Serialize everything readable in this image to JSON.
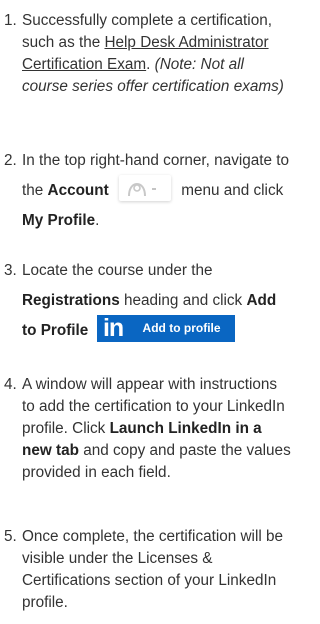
{
  "steps": [
    {
      "num": "1.",
      "l1": "Successfully complete a certification,",
      "l2a": "such as the ",
      "l2link": "Help Desk Administrator",
      "l3link": "Certification Exam",
      "l3b": ". ",
      "l3note": "(Note: Not all",
      "l4note": "course series offer certification exams)"
    },
    {
      "num": "2.",
      "l1": "In the top right-hand corner, navigate to",
      "l2a": "the ",
      "l2bold": "Account",
      "l2c": "menu and click",
      "l3bold": "My Profile",
      "l3b": "."
    },
    {
      "num": "3.",
      "l1": "Locate the course under the",
      "l2bold": "Registrations",
      "l2b": " heading and click ",
      "l2bold2": "Add",
      "l3bold": "to Profile",
      "logo_text": "in",
      "button_label": "Add to profile"
    },
    {
      "num": "4.",
      "l1": "A window will appear with instructions",
      "l2": "to add the certification to your LinkedIn",
      "l3a": "profile. Click ",
      "l3bold": "Launch LinkedIn in a",
      "l4bold": "new tab",
      "l4b": " and copy and paste the values",
      "l5": "provided in each field."
    },
    {
      "num": "5.",
      "l1": "Once complete, the certification will be",
      "l2": "visible under the Licenses &",
      "l3": "Certifications section of your LinkedIn",
      "l4": "profile."
    }
  ],
  "colors": {
    "text": "#333333",
    "linkedin": "#0a66c2"
  },
  "icons": {
    "account": "user-avatar-icon",
    "dropdown": "chevron-down-icon",
    "linkedin": "linkedin-logo-icon"
  }
}
